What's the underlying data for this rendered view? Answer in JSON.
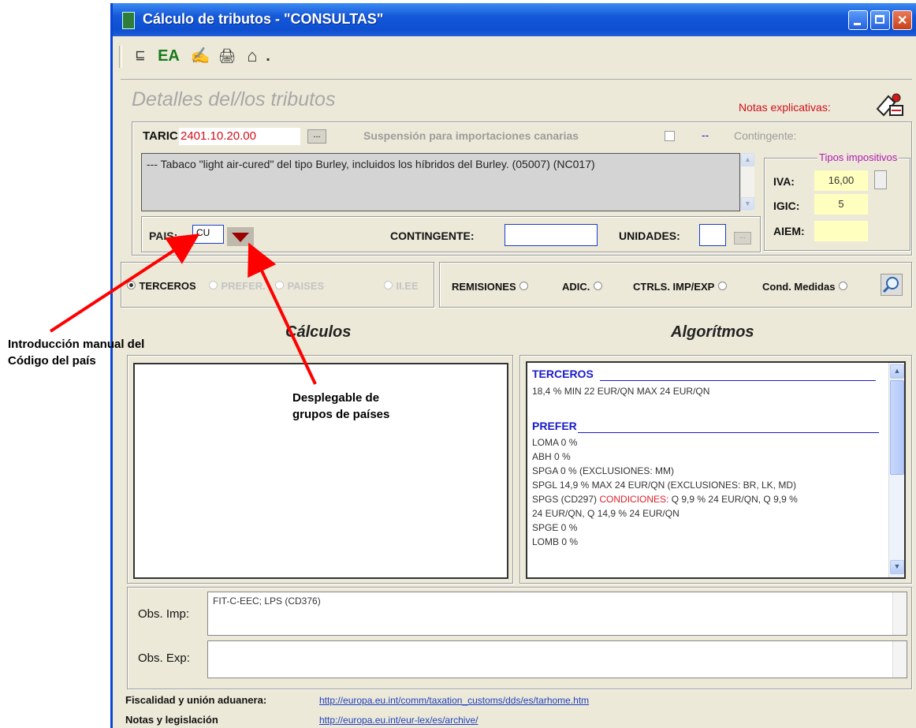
{
  "window": {
    "title": "Cálculo de tributos  -  \"CONSULTAS\"",
    "toolbar": [
      {
        "icon": "list-icon",
        "label": "⊑"
      },
      {
        "icon": "ea-icon",
        "label": "EA"
      },
      {
        "icon": "pen-icon",
        "label": "✍"
      },
      {
        "icon": "printer-icon",
        "label": "🖨"
      },
      {
        "icon": "home-icon",
        "label": "⌂"
      },
      {
        "icon": "dropdown-dot",
        "label": "."
      }
    ]
  },
  "panel": {
    "title": "Detalles del/los tributos",
    "notas_label": "Notas explicativas:"
  },
  "taric": {
    "label": "TARIC:",
    "code": "2401.10.20.00",
    "browse_label": "...",
    "suspension_label": "Suspensión para importaciones canarias",
    "suspension_value": "--",
    "contingente_label": "Contingente:",
    "description": "--- Tabaco \"light air-cured\" del tipo Burley, incluidos los híbridos del Burley. (05007) (NC017)"
  },
  "tipos": {
    "group_label": "Tipos impositivos",
    "iva_label": "IVA:",
    "iva_value": "16,00",
    "igic_label": "IGIC:",
    "igic_value": "5",
    "aiem_label": "AIEM:",
    "aiem_value": ""
  },
  "pais_row": {
    "pais_label": "PAIS:",
    "pais_value": "CU",
    "contingente_label": "CONTINGENTE:",
    "contingente_value": "",
    "unidades_label": "UNIDADES:",
    "unidades_value": "",
    "unidades_btn": "..."
  },
  "radios_left": [
    {
      "label": "TERCEROS",
      "selected": true,
      "enabled": true
    },
    {
      "label": "PREFER.",
      "selected": false,
      "enabled": false
    },
    {
      "label": "PAISES",
      "selected": false,
      "enabled": false
    },
    {
      "label": "II.EE",
      "selected": false,
      "enabled": false
    }
  ],
  "radios_right": [
    {
      "label": "REMISIONES"
    },
    {
      "label": "ADIC."
    },
    {
      "label": "CTRLS. IMP/EXP"
    },
    {
      "label": "Cond. Medidas"
    }
  ],
  "calculos": {
    "heading": "Cálculos"
  },
  "algoritmos": {
    "heading": "Algorítmos",
    "sections": [
      {
        "title": "TERCEROS",
        "lines": [
          " 18,4 % MIN 22 EUR/QN MAX 24 EUR/QN"
        ]
      },
      {
        "title": "PREFER",
        "lines": [
          "LOMA 0 %",
          " ABH 0 %",
          " SPGA 0 % (EXCLUSIONES: MM)",
          " SPGL 14,9 % MAX 24 EUR/QN (EXCLUSIONES: BR, LK, MD)"
        ]
      },
      {
        "spgs_prefix": "SPGS (CD297) ",
        "spgs_cond": "CONDICIONES:",
        "spgs_rest": " Q 9,9 % 24 EUR/QN, Q 9,9 %",
        "lines": [
          "24 EUR/QN, Q 14,9 % 24 EUR/QN",
          " SPGE 0 %",
          " LOMB 0 %"
        ]
      }
    ]
  },
  "obs": {
    "imp_label": "Obs. Imp:",
    "imp_value": "FIT-C-EEC; LPS (CD376)",
    "exp_label": "Obs. Exp:",
    "exp_value": ""
  },
  "footer": {
    "fiscalidad_label": "Fiscalidad y unión aduanera:",
    "fiscalidad_link": "http://europa.eu.int/comm/taxation_customs/dds/es/tarhome.htm",
    "notas_label": "Notas y legislación",
    "notas_link": "http://europa.eu.int/eur-lex/es/archive/"
  },
  "annotations": {
    "manual_line1": "Introducción manual del",
    "manual_line2": "Código del país",
    "dropdown_line1": "Desplegable de",
    "dropdown_line2": "grupos de países"
  },
  "colors": {
    "title_blue": "#0d4fd0",
    "taric_red": "#d0101a",
    "alg_blue": "#1a1acc",
    "arrow_red": "#ff0000"
  }
}
